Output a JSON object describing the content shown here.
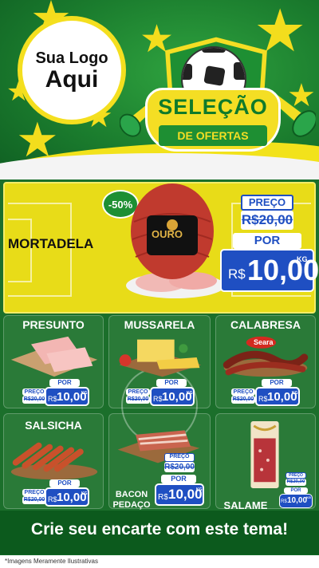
{
  "header": {
    "logo_line1": "Sua Logo",
    "logo_line2": "Aqui",
    "title": "SELEÇÃO",
    "subtitle": "DE OFERTAS"
  },
  "hero": {
    "name": "MORTADELA",
    "discount": "-50%",
    "brand": "OURO",
    "old_label": "PREÇO",
    "old_price": "R$20,00",
    "new_label": "POR",
    "currency": "R$",
    "new_price": "10,00",
    "unit": "KG"
  },
  "products": [
    {
      "name": "PRESUNTO",
      "old_label": "PREÇO",
      "old_price": "R$20,00",
      "new_label": "POR",
      "currency": "R$",
      "new_price": "10,00",
      "unit": "KG"
    },
    {
      "name": "MUSSARELA",
      "old_label": "PREÇO",
      "old_price": "R$20,00",
      "new_label": "POR",
      "currency": "R$",
      "new_price": "10,00",
      "unit": "KG"
    },
    {
      "name": "CALABRESA",
      "brand": "Seara",
      "old_label": "PREÇO",
      "old_price": "R$20,00",
      "new_label": "POR",
      "currency": "R$",
      "new_price": "10,00",
      "unit": "KG"
    },
    {
      "name": "SALSICHA",
      "old_label": "PREÇO",
      "old_price": "R$20,00",
      "new_label": "POR",
      "currency": "R$",
      "new_price": "10,00",
      "unit": "KG"
    },
    {
      "name_line1": "BACON",
      "name_line2": "PEDAÇO",
      "old_label": "PREÇO",
      "old_price": "R$20,00",
      "new_label": "POR",
      "currency": "R$",
      "new_price": "10,00",
      "unit": "KG"
    },
    {
      "name": "SALAME",
      "old_label": "PREÇO",
      "old_price": "R$20,00",
      "new_label": "POR",
      "currency": "R$",
      "new_price": "10,00",
      "unit": "KG"
    }
  ],
  "footer": {
    "cta": "Crie seu encarte com este tema!",
    "disclaimer": "*Imagens Meramente Ilustrativas"
  },
  "colors": {
    "green_dark": "#0f6a24",
    "yellow": "#f4de24",
    "blue": "#1f4fc2"
  }
}
